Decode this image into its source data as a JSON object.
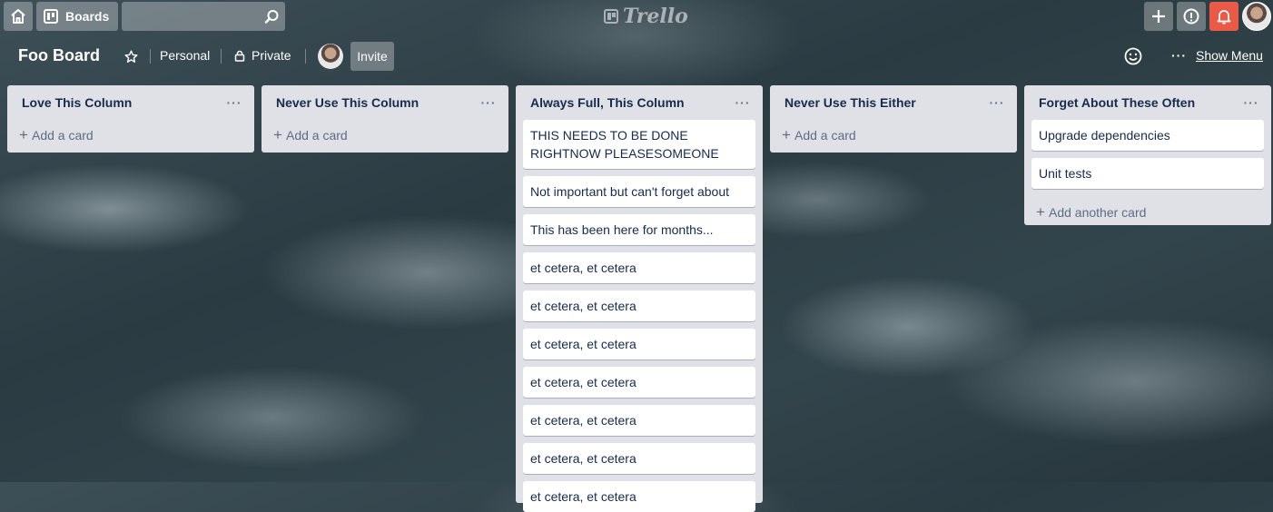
{
  "nav": {
    "boards_label": "Boards",
    "logo_text": "Trello"
  },
  "board": {
    "name": "Foo Board",
    "team_label": "Personal",
    "visibility_label": "Private",
    "invite_label": "Invite",
    "menu_label": "Show Menu"
  },
  "colors": {
    "notification": "#eb5a46",
    "list_bg": "#dfe1e6"
  },
  "lists": [
    {
      "title": "Love This Column",
      "cards": [],
      "add_label": "Add a card"
    },
    {
      "title": "Never Use This Column",
      "cards": [],
      "add_label": "Add a card"
    },
    {
      "title": "Always Full, This Column",
      "cards": [
        "THIS NEEDS TO BE DONE RIGHTNOW PLEASESOMEONE",
        "Not important but can't forget about",
        "This has been here for months...",
        "et cetera, et cetera",
        "et cetera, et cetera",
        "et cetera, et cetera",
        "et cetera, et cetera",
        "et cetera, et cetera",
        "et cetera, et cetera",
        "et cetera, et cetera"
      ]
    },
    {
      "title": "Never Use This Either",
      "cards": [],
      "add_label": "Add a card"
    },
    {
      "title": "Forget About These Often",
      "cards": [
        "Upgrade dependencies",
        "Unit tests"
      ],
      "add_label": "Add another card"
    }
  ]
}
